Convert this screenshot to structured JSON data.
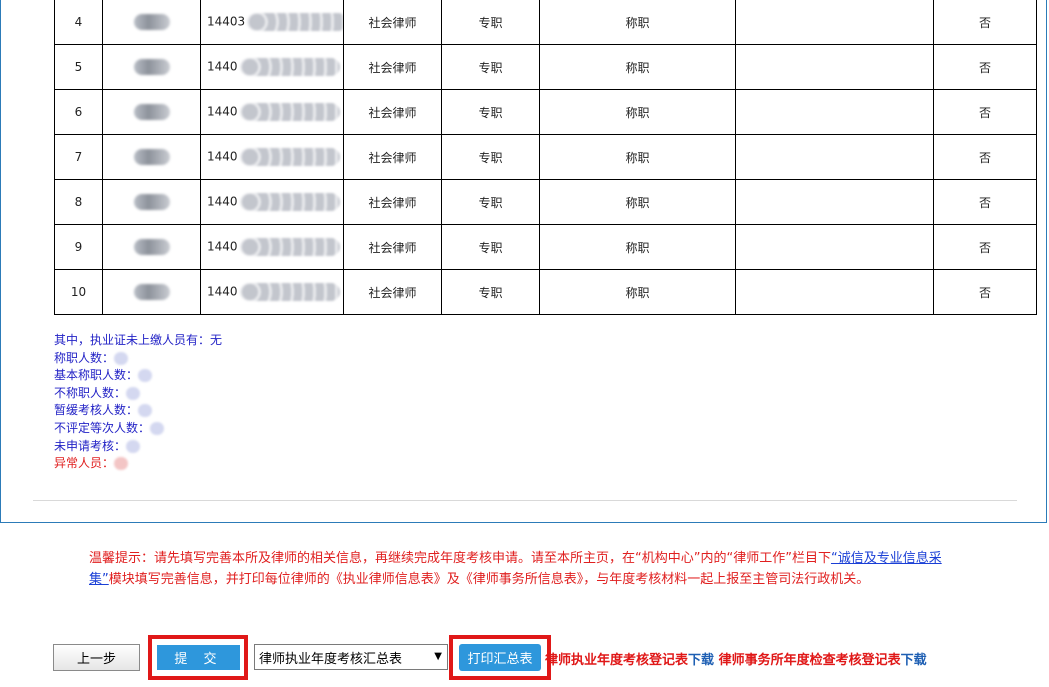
{
  "members": {
    "rows": [
      {
        "no": "4",
        "cert_prefix": "14403",
        "type": "社会律师",
        "mode": "专职",
        "evaluation": "称职",
        "remark": "",
        "abnormal": "否"
      },
      {
        "no": "5",
        "cert_prefix": "1440",
        "type": "社会律师",
        "mode": "专职",
        "evaluation": "称职",
        "remark": "",
        "abnormal": "否"
      },
      {
        "no": "6",
        "cert_prefix": "1440",
        "type": "社会律师",
        "mode": "专职",
        "evaluation": "称职",
        "remark": "",
        "abnormal": "否"
      },
      {
        "no": "7",
        "cert_prefix": "1440",
        "type": "社会律师",
        "mode": "专职",
        "evaluation": "称职",
        "remark": "",
        "abnormal": "否"
      },
      {
        "no": "8",
        "cert_prefix": "1440",
        "type": "社会律师",
        "mode": "专职",
        "evaluation": "称职",
        "remark": "",
        "abnormal": "否"
      },
      {
        "no": "9",
        "cert_prefix": "1440",
        "type": "社会律师",
        "mode": "专职",
        "evaluation": "称职",
        "remark": "",
        "abnormal": "否"
      },
      {
        "no": "10",
        "cert_prefix": "1440",
        "type": "社会律师",
        "mode": "专职",
        "evaluation": "称职",
        "remark": "",
        "abnormal": "否"
      }
    ]
  },
  "summary": {
    "unpaid": "其中，执业证未上缴人员有：无",
    "competent": "称职人数：",
    "basic_competent": "基本称职人数：",
    "incompetent": "不称职人数：",
    "deferred": "暂缓考核人数：",
    "not_graded": "不评定等次人数：",
    "not_applied": "未申请考核：",
    "abnormal": "异常人员："
  },
  "notice": {
    "part1": "温馨提示：请先填写完善本所及律师的相关信息，再继续完成年度考核申请。请至本所主页，在“机构中心”内的“律师工作”栏目下",
    "link": "“诚信及专业信息采集”",
    "part2": "模块填写完善信息，并打印每位律师的《执业律师信息表》及《律师事务所信息表》，与年度考核材料一起上报至主管司法行政机关。"
  },
  "actions": {
    "prev_label": "上一步",
    "submit_label": "提 交",
    "select_value": "律师执业年度考核汇总表",
    "print_label": "打印汇总表",
    "download1_text": "律师执业年度考核登记表",
    "download1_link": "下载",
    "download2_text": "律师事务所年度检查考核登记表",
    "download2_link": "下载"
  },
  "colors": {
    "accent_blue": "#2e97dc",
    "highlight_red": "#e01818",
    "summary_blue": "#2323c6"
  }
}
